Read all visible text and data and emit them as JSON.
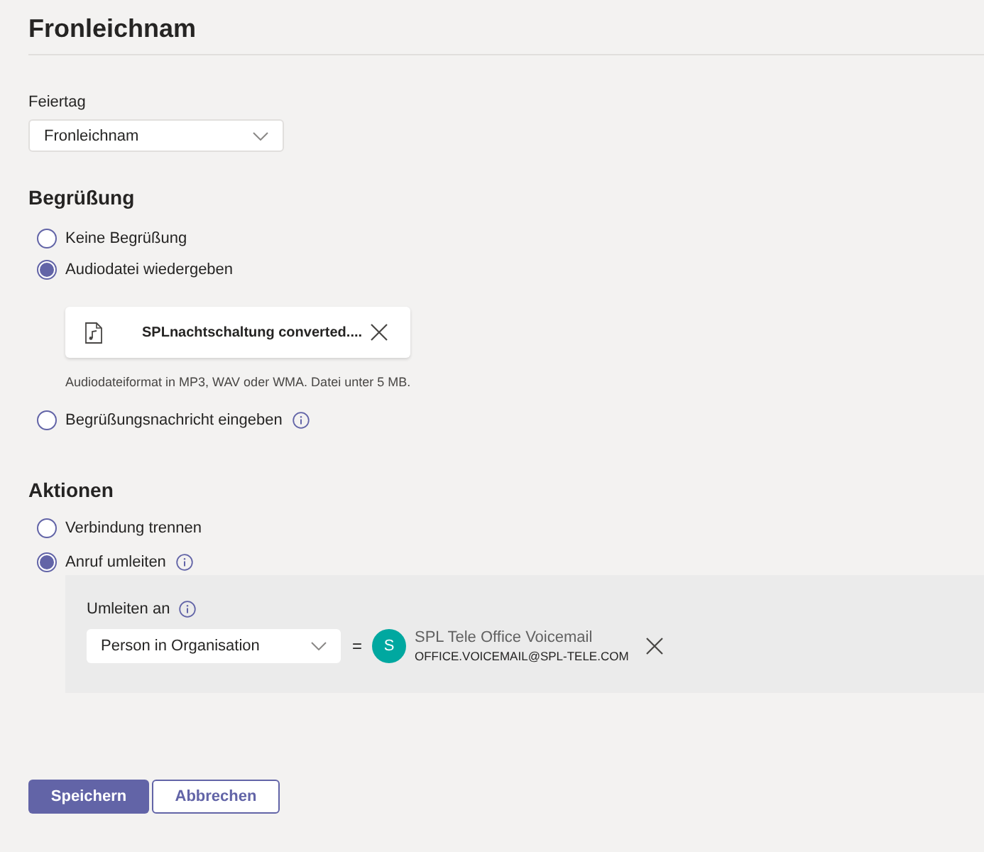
{
  "page": {
    "title": "Fronleichnam"
  },
  "holiday": {
    "label": "Feiertag",
    "value": "Fronleichnam"
  },
  "greeting": {
    "heading": "Begrüßung",
    "options": [
      {
        "label": "Keine Begrüßung",
        "selected": false,
        "info": false
      },
      {
        "label": "Audiodatei wiedergeben",
        "selected": true,
        "info": false,
        "file": {
          "name": "SPLnachtschaltung converted....",
          "hint": "Audiodateiformat in MP3, WAV oder WMA. Datei unter 5 MB."
        }
      },
      {
        "label": "Begrüßungsnachricht eingeben",
        "selected": false,
        "info": true
      }
    ]
  },
  "actions": {
    "heading": "Aktionen",
    "options": [
      {
        "label": "Verbindung trennen",
        "selected": false,
        "info": false
      },
      {
        "label": "Anruf umleiten",
        "selected": true,
        "info": true,
        "redirect": {
          "label": "Umleiten an",
          "target_type": "Person in Organisation",
          "operator": "=",
          "contact": {
            "initial": "S",
            "name": "SPL Tele Office Voicemail",
            "email": "OFFICE.VOICEMAIL@SPL-TELE.COM"
          }
        }
      }
    ]
  },
  "buttons": [
    {
      "label": "Speichern",
      "kind": "primary"
    },
    {
      "label": "Abbrechen",
      "kind": "secondary"
    }
  ]
}
